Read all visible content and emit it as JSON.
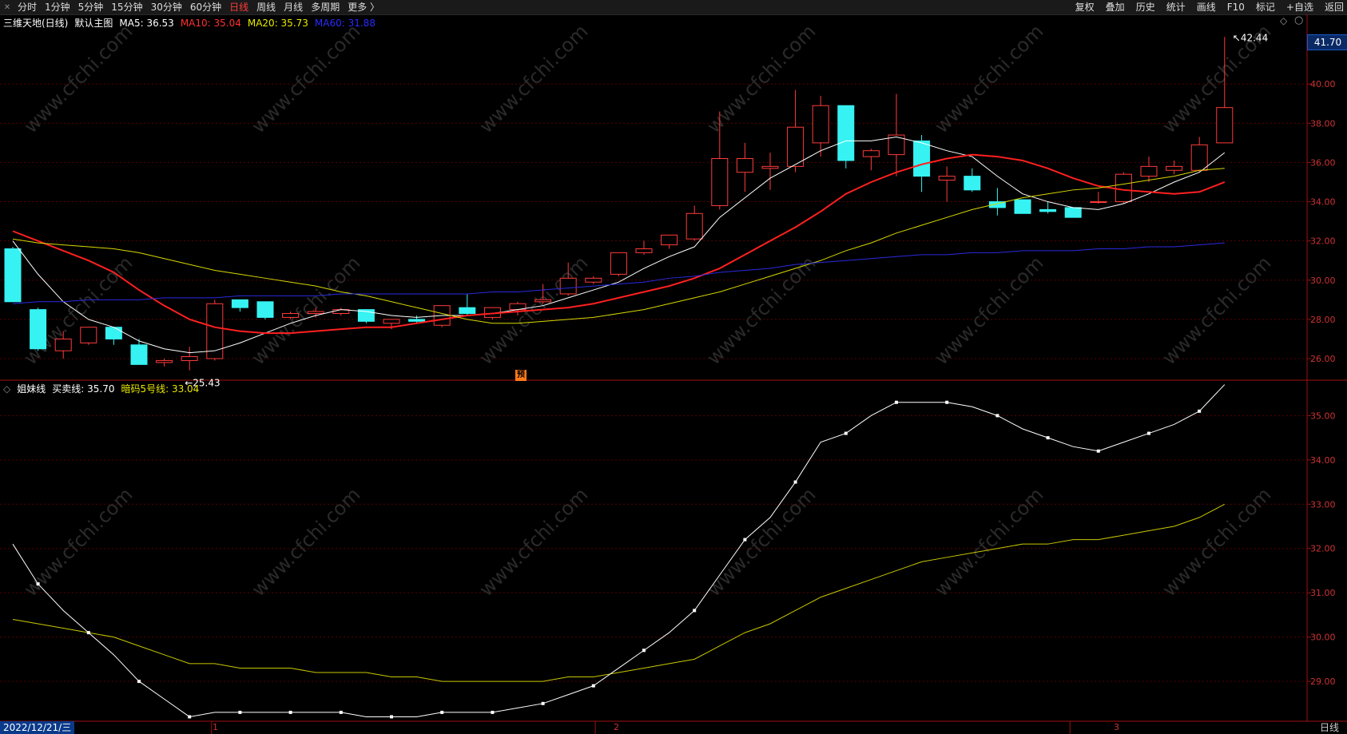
{
  "toolbar": {
    "left_items": [
      "分时",
      "1分钟",
      "5分钟",
      "15分钟",
      "30分钟",
      "60分钟",
      "日线",
      "周线",
      "月线",
      "多周期",
      "更多 〉"
    ],
    "active_index": 6,
    "right_items": [
      "复权",
      "叠加",
      "历史",
      "统计",
      "画线",
      "F10",
      "标记",
      "+自选",
      "返回"
    ]
  },
  "main_info": {
    "stock": "三维天地(日线)",
    "template": "默认主图",
    "ma5": "MA5: 36.53",
    "ma10": "MA10: 35.04",
    "ma20": "MA20: 35.73",
    "ma60": "MA60: 31.88"
  },
  "sub_info": {
    "name": "姐妹线",
    "line1": "买卖线: 35.70",
    "line2": "暗码5号线: 33.04"
  },
  "price_flag": "41.70",
  "high_label": "42.44",
  "low_label": "25.43",
  "yu_badge": "预",
  "date_label": "2022/12/21/三",
  "period_label": "日线",
  "x_ticks": [
    "1",
    "2",
    "3"
  ],
  "colors": {
    "up": "#ff3b3b",
    "down": "#36f2f2",
    "ma5": "#ffffff",
    "ma10": "#ff2020",
    "ma20": "#d8d800",
    "ma60": "#2a2adf",
    "grid": "#5a0000"
  },
  "chart_data": [
    {
      "type": "candlestick",
      "yticks": [
        26,
        28,
        30,
        32,
        34,
        36,
        38,
        40
      ],
      "ylim": [
        24.9,
        42.9
      ],
      "candles": [
        {
          "o": 31.6,
          "h": 31.7,
          "l": 28.9,
          "c": 28.9
        },
        {
          "o": 28.5,
          "h": 28.6,
          "l": 26.4,
          "c": 26.5
        },
        {
          "o": 26.4,
          "h": 27.4,
          "l": 26.0,
          "c": 27.0
        },
        {
          "o": 26.8,
          "h": 27.6,
          "l": 26.7,
          "c": 27.6
        },
        {
          "o": 27.6,
          "h": 27.6,
          "l": 26.7,
          "c": 27.0
        },
        {
          "o": 26.7,
          "h": 27.0,
          "l": 25.7,
          "c": 25.7
        },
        {
          "o": 25.8,
          "h": 26.0,
          "l": 25.6,
          "c": 25.9
        },
        {
          "o": 25.9,
          "h": 26.6,
          "l": 25.4,
          "c": 26.1
        },
        {
          "o": 26.0,
          "h": 29.0,
          "l": 25.9,
          "c": 28.8
        },
        {
          "o": 29.0,
          "h": 29.0,
          "l": 28.4,
          "c": 28.6
        },
        {
          "o": 28.9,
          "h": 28.9,
          "l": 28.0,
          "c": 28.1
        },
        {
          "o": 28.1,
          "h": 28.4,
          "l": 28.0,
          "c": 28.3
        },
        {
          "o": 28.3,
          "h": 28.6,
          "l": 28.1,
          "c": 28.4
        },
        {
          "o": 28.3,
          "h": 28.6,
          "l": 28.2,
          "c": 28.5
        },
        {
          "o": 28.5,
          "h": 28.5,
          "l": 27.8,
          "c": 27.9
        },
        {
          "o": 27.8,
          "h": 28.0,
          "l": 27.5,
          "c": 28.0
        },
        {
          "o": 28.0,
          "h": 28.2,
          "l": 27.8,
          "c": 27.9
        },
        {
          "o": 27.7,
          "h": 28.7,
          "l": 27.6,
          "c": 28.7
        },
        {
          "o": 28.6,
          "h": 29.3,
          "l": 28.2,
          "c": 28.3
        },
        {
          "o": 28.1,
          "h": 28.6,
          "l": 28.0,
          "c": 28.6
        },
        {
          "o": 28.5,
          "h": 28.9,
          "l": 28.2,
          "c": 28.8
        },
        {
          "o": 28.9,
          "h": 29.8,
          "l": 28.8,
          "c": 29.0
        },
        {
          "o": 29.3,
          "h": 30.9,
          "l": 29.2,
          "c": 30.1
        },
        {
          "o": 29.9,
          "h": 30.2,
          "l": 29.8,
          "c": 30.1
        },
        {
          "o": 30.3,
          "h": 31.4,
          "l": 30.2,
          "c": 31.4
        },
        {
          "o": 31.4,
          "h": 32.0,
          "l": 31.3,
          "c": 31.6
        },
        {
          "o": 31.8,
          "h": 32.3,
          "l": 31.6,
          "c": 32.3
        },
        {
          "o": 32.1,
          "h": 33.8,
          "l": 32.0,
          "c": 33.4
        },
        {
          "o": 33.8,
          "h": 38.6,
          "l": 33.6,
          "c": 36.2
        },
        {
          "o": 35.5,
          "h": 37.0,
          "l": 34.5,
          "c": 36.2
        },
        {
          "o": 35.7,
          "h": 36.5,
          "l": 34.6,
          "c": 35.8
        },
        {
          "o": 35.8,
          "h": 39.7,
          "l": 35.5,
          "c": 37.8
        },
        {
          "o": 37.0,
          "h": 39.4,
          "l": 36.3,
          "c": 38.9
        },
        {
          "o": 38.9,
          "h": 38.9,
          "l": 35.7,
          "c": 36.1
        },
        {
          "o": 36.3,
          "h": 36.7,
          "l": 35.6,
          "c": 36.6
        },
        {
          "o": 36.4,
          "h": 39.5,
          "l": 35.3,
          "c": 37.4
        },
        {
          "o": 37.1,
          "h": 37.4,
          "l": 34.5,
          "c": 35.3
        },
        {
          "o": 35.1,
          "h": 35.8,
          "l": 34.0,
          "c": 35.3
        },
        {
          "o": 35.3,
          "h": 35.7,
          "l": 34.5,
          "c": 34.6
        },
        {
          "o": 34.0,
          "h": 34.7,
          "l": 33.3,
          "c": 33.7
        },
        {
          "o": 34.1,
          "h": 34.1,
          "l": 33.4,
          "c": 33.4
        },
        {
          "o": 33.6,
          "h": 34.0,
          "l": 33.4,
          "c": 33.5
        },
        {
          "o": 33.7,
          "h": 33.7,
          "l": 33.2,
          "c": 33.2
        },
        {
          "o": 34.0,
          "h": 34.5,
          "l": 33.9,
          "c": 34.0
        },
        {
          "o": 34.0,
          "h": 35.5,
          "l": 33.9,
          "c": 35.4
        },
        {
          "o": 35.3,
          "h": 36.3,
          "l": 35.0,
          "c": 35.8
        },
        {
          "o": 35.6,
          "h": 36.1,
          "l": 35.4,
          "c": 35.8
        },
        {
          "o": 35.6,
          "h": 37.3,
          "l": 35.5,
          "c": 36.9
        },
        {
          "o": 37.0,
          "h": 42.4,
          "l": 37.0,
          "c": 38.8
        }
      ],
      "series": [
        {
          "name": "MA5",
          "values": [
            32.0,
            30.3,
            28.9,
            28.0,
            27.6,
            26.9,
            26.5,
            26.3,
            26.4,
            26.8,
            27.3,
            27.8,
            28.2,
            28.5,
            28.4,
            28.2,
            28.1,
            28.2,
            28.2,
            28.3,
            28.5,
            28.7,
            29.1,
            29.5,
            29.9,
            30.6,
            31.2,
            31.7,
            33.2,
            34.2,
            35.2,
            35.9,
            36.6,
            37.1,
            37.1,
            37.3,
            37.0,
            36.6,
            36.3,
            35.3,
            34.4,
            34.0,
            33.7,
            33.6,
            33.9,
            34.4,
            35.0,
            35.5,
            36.5
          ]
        },
        {
          "name": "MA10",
          "values": [
            32.5,
            32.0,
            31.5,
            31.0,
            30.4,
            29.5,
            28.7,
            28.0,
            27.6,
            27.4,
            27.3,
            27.3,
            27.4,
            27.5,
            27.6,
            27.6,
            27.8,
            28.0,
            28.2,
            28.3,
            28.4,
            28.5,
            28.6,
            28.8,
            29.1,
            29.4,
            29.7,
            30.1,
            30.6,
            31.3,
            32.0,
            32.7,
            33.5,
            34.4,
            35.0,
            35.5,
            35.9,
            36.2,
            36.4,
            36.3,
            36.1,
            35.7,
            35.2,
            34.8,
            34.6,
            34.5,
            34.4,
            34.5,
            35.0
          ]
        },
        {
          "name": "MA20",
          "values": [
            32.1,
            31.9,
            31.8,
            31.7,
            31.6,
            31.4,
            31.1,
            30.8,
            30.5,
            30.3,
            30.1,
            29.9,
            29.7,
            29.4,
            29.2,
            28.9,
            28.6,
            28.3,
            28.0,
            27.8,
            27.8,
            27.9,
            28.0,
            28.1,
            28.3,
            28.5,
            28.8,
            29.1,
            29.4,
            29.8,
            30.2,
            30.6,
            31.0,
            31.5,
            31.9,
            32.4,
            32.8,
            33.2,
            33.6,
            33.9,
            34.2,
            34.4,
            34.6,
            34.7,
            34.9,
            35.1,
            35.3,
            35.6,
            35.7
          ]
        },
        {
          "name": "MA60",
          "values": [
            28.8,
            28.9,
            28.9,
            29.0,
            29.0,
            29.0,
            29.1,
            29.1,
            29.1,
            29.2,
            29.2,
            29.2,
            29.2,
            29.3,
            29.3,
            29.3,
            29.3,
            29.3,
            29.3,
            29.4,
            29.4,
            29.5,
            29.6,
            29.7,
            29.8,
            29.9,
            30.1,
            30.2,
            30.4,
            30.5,
            30.6,
            30.8,
            30.9,
            31.0,
            31.1,
            31.2,
            31.3,
            31.3,
            31.4,
            31.4,
            31.5,
            31.5,
            31.5,
            31.6,
            31.6,
            31.7,
            31.7,
            31.8,
            31.9
          ]
        }
      ]
    },
    {
      "type": "line",
      "title": "姐妹线",
      "yticks": [
        29,
        30,
        31,
        32,
        33,
        34,
        35
      ],
      "ylim": [
        28.1,
        35.8
      ],
      "series": [
        {
          "name": "买卖线",
          "values": [
            32.1,
            31.2,
            30.6,
            30.1,
            29.6,
            29.0,
            28.6,
            28.2,
            28.3,
            28.3,
            28.3,
            28.3,
            28.3,
            28.3,
            28.2,
            28.2,
            28.2,
            28.3,
            28.3,
            28.3,
            28.4,
            28.5,
            28.7,
            28.9,
            29.3,
            29.7,
            30.1,
            30.6,
            31.4,
            32.2,
            32.7,
            33.5,
            34.4,
            34.6,
            35.0,
            35.3,
            35.3,
            35.3,
            35.2,
            35.0,
            34.7,
            34.5,
            34.3,
            34.2,
            34.4,
            34.6,
            34.8,
            35.1,
            35.7
          ]
        },
        {
          "name": "暗码5号线",
          "values": [
            30.4,
            30.3,
            30.2,
            30.1,
            30.0,
            29.8,
            29.6,
            29.4,
            29.4,
            29.3,
            29.3,
            29.3,
            29.2,
            29.2,
            29.2,
            29.1,
            29.1,
            29.0,
            29.0,
            29.0,
            29.0,
            29.0,
            29.1,
            29.1,
            29.2,
            29.3,
            29.4,
            29.5,
            29.8,
            30.1,
            30.3,
            30.6,
            30.9,
            31.1,
            31.3,
            31.5,
            31.7,
            31.8,
            31.9,
            32.0,
            32.1,
            32.1,
            32.2,
            32.2,
            32.3,
            32.4,
            32.5,
            32.7,
            33.0
          ]
        }
      ]
    }
  ]
}
